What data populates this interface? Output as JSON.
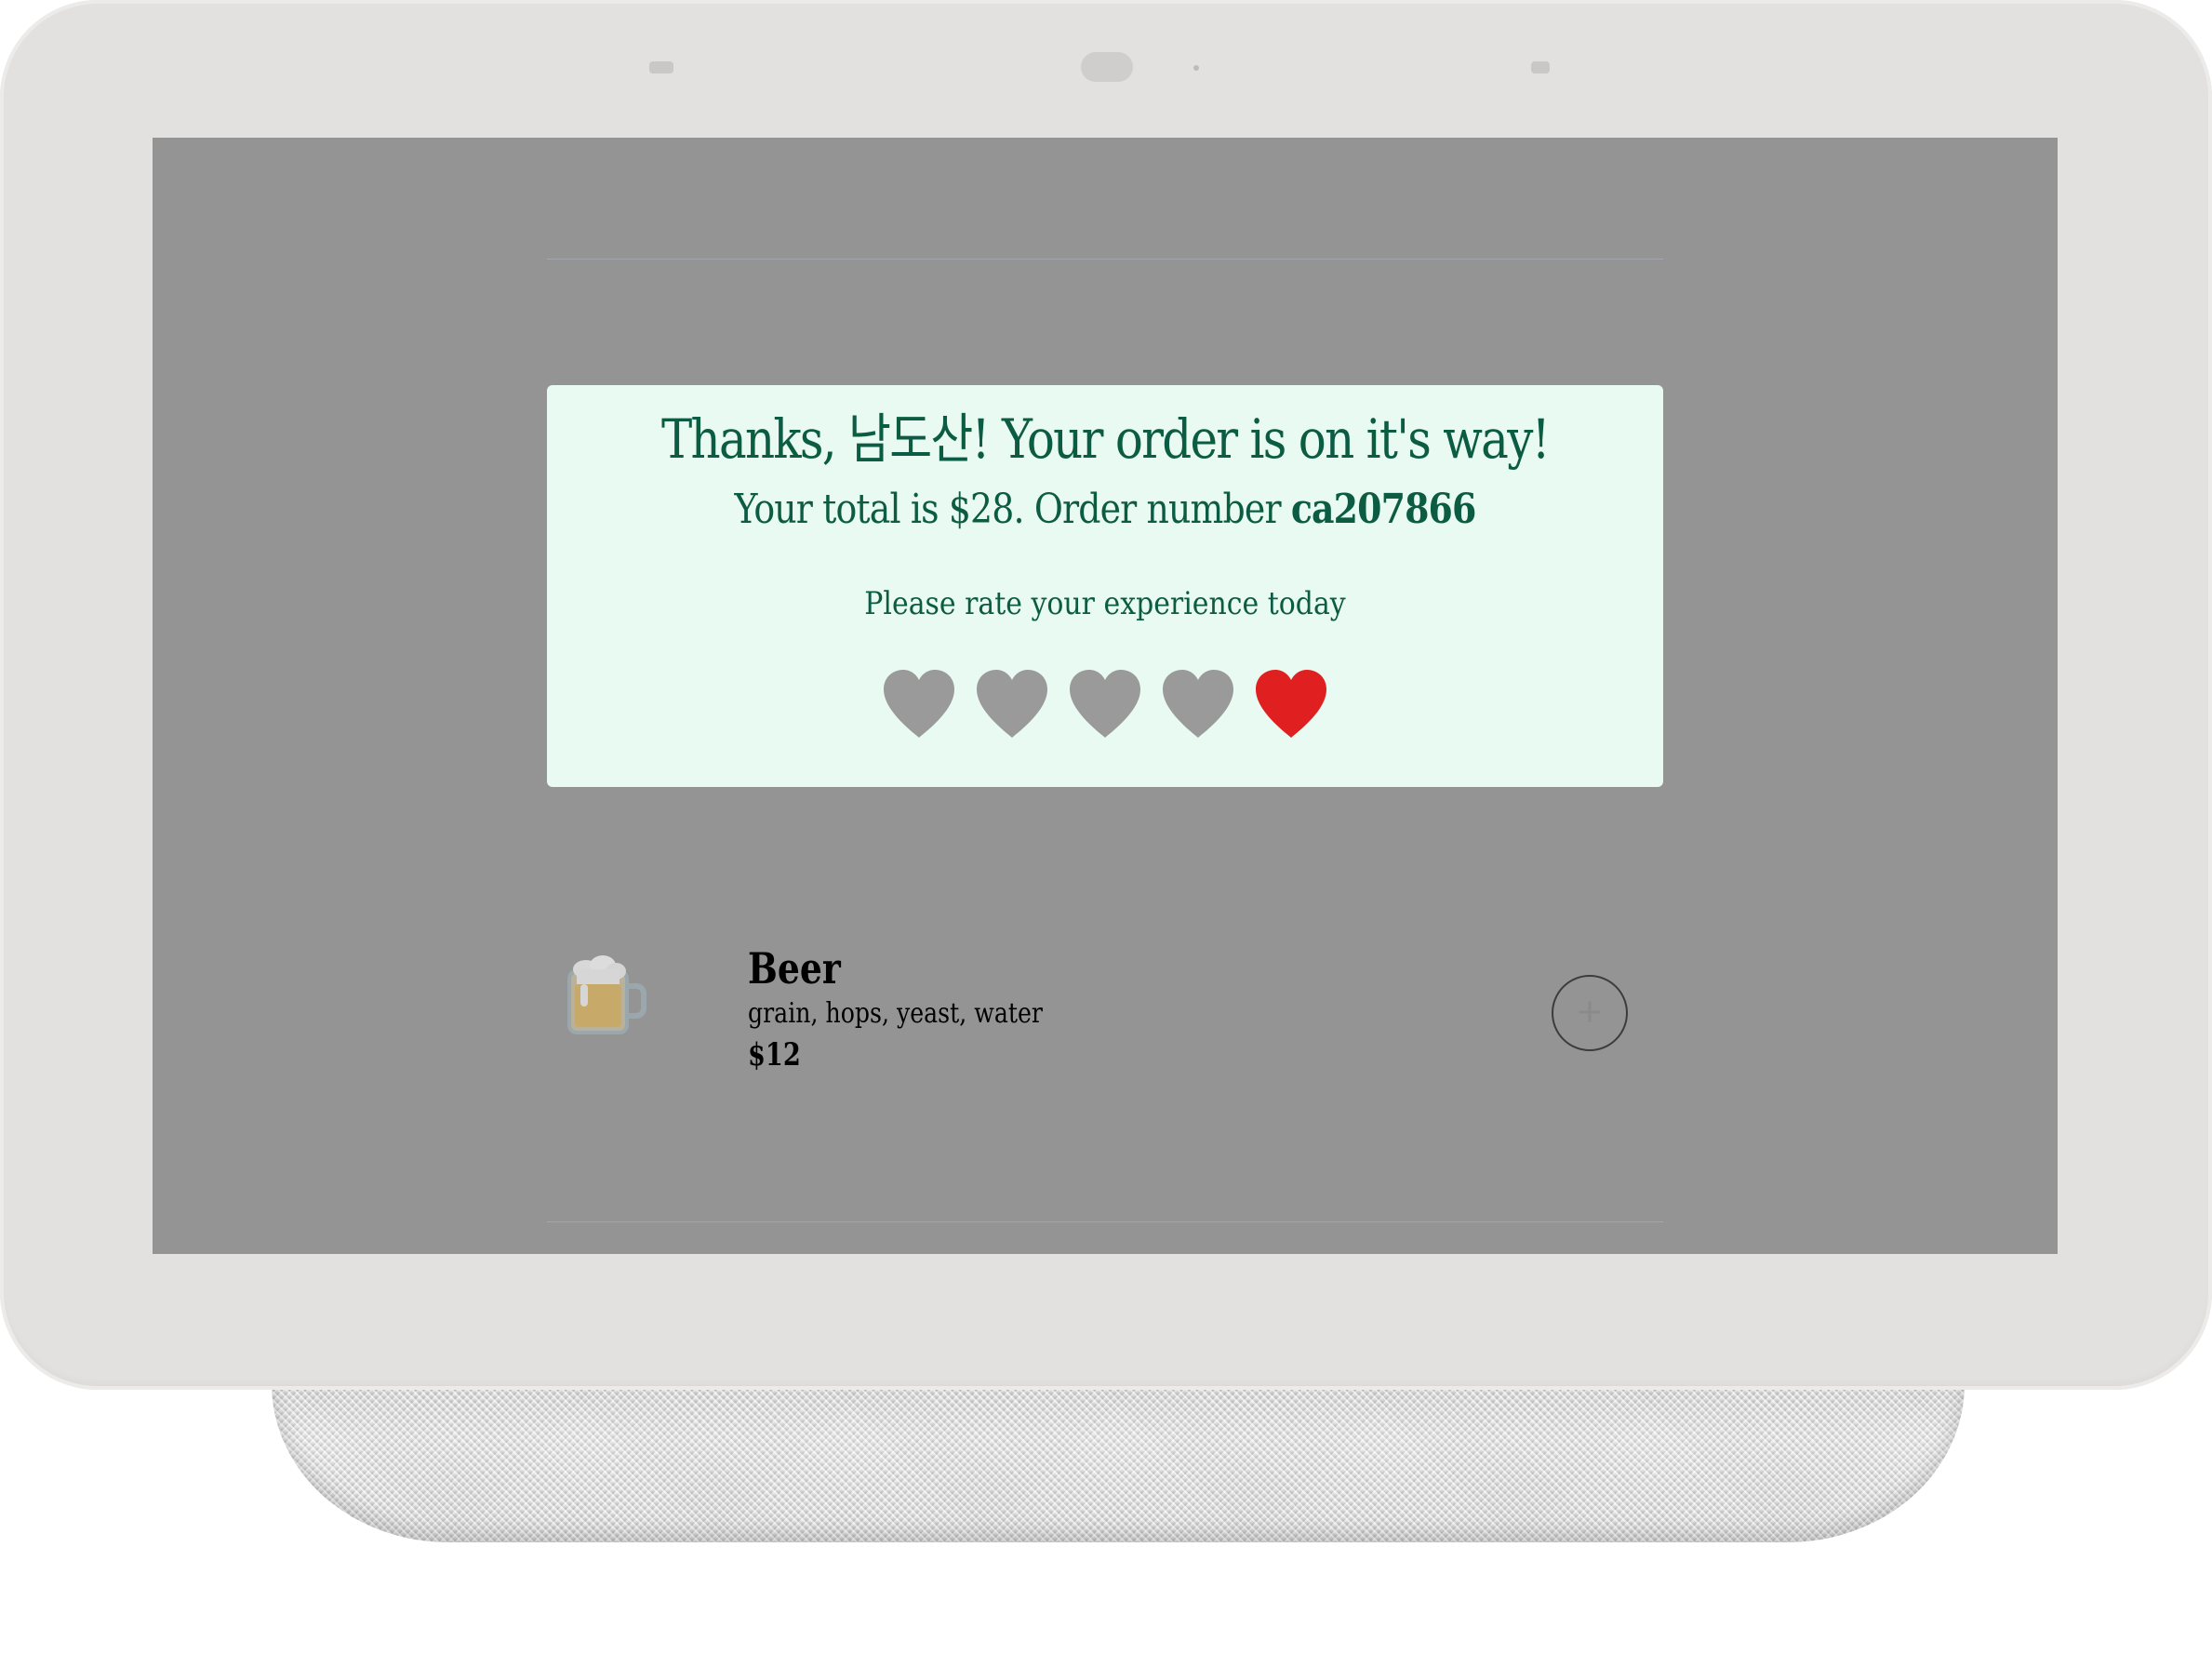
{
  "device": {
    "name": "smart-display"
  },
  "confirmation": {
    "title": "Thanks, 남도산! Your order is on it's way!",
    "total_prefix": "Your total is $28. Order number ",
    "order_number": "ca207866",
    "rate_prompt": "Please rate your experience today",
    "rating": {
      "max": 5,
      "selected": 5,
      "active_color": "#e02020",
      "inactive_color": "#9a9a9a"
    }
  },
  "menu_item": {
    "icon": "beer-mug-icon",
    "name": "Beer",
    "description": "grain, hops, yeast, water",
    "price": "$12",
    "add_label": "+"
  },
  "colors": {
    "overlay": "#949494",
    "card_bg": "#e8faf1",
    "text_green": "#0c5c43",
    "bezel": "#e2e1e0"
  }
}
